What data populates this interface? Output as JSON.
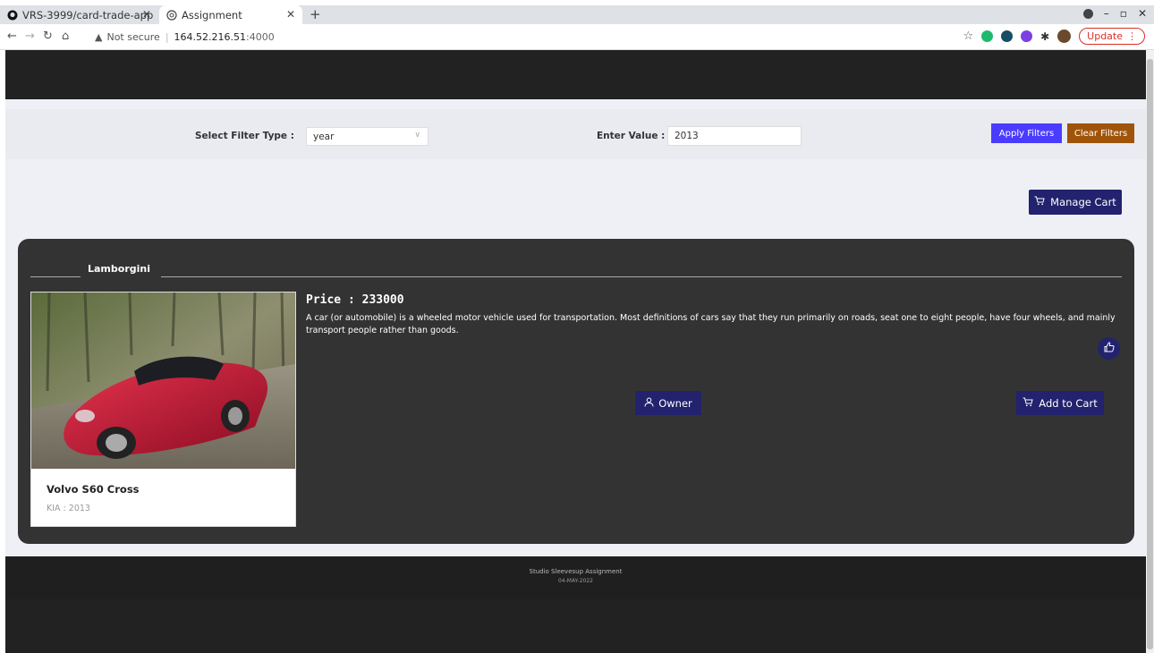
{
  "browser": {
    "tabs": [
      {
        "label": "VRS-3999/card-trade-app",
        "icon": "github-icon"
      },
      {
        "label": "Assignment",
        "icon": "globe-icon"
      }
    ],
    "address": {
      "security": "Not secure",
      "host": "164.52.216.51",
      "port": ":4000"
    },
    "update_label": "Update"
  },
  "filters": {
    "type_label": "Select Filter Type :",
    "type_value": "year",
    "value_label": "Enter Value :",
    "value": "2013",
    "apply_label": "Apply Filters",
    "clear_label": "Clear Filters"
  },
  "manage_cart_label": "Manage Cart",
  "listing": {
    "brand": "Lamborgini",
    "price": "Price : 233000",
    "description": "A car (or automobile) is a wheeled motor vehicle used for transportation. Most definitions of cars say that they run primarily on roads, seat one to eight people, have four wheels, and mainly transport people rather than goods.",
    "card": {
      "name": "Volvo S60 Cross",
      "subtitle": "KIA : 2013"
    },
    "owner_label": "Owner",
    "add_to_cart_label": "Add to Cart"
  },
  "footer": {
    "title": "Studio Sleevesup Assignment",
    "date": "04-MAY-2022"
  },
  "colors": {
    "primary": "#22226e",
    "apply": "#4a3cff",
    "clear": "#a0540a",
    "panel": "#333333",
    "header": "#222222"
  }
}
